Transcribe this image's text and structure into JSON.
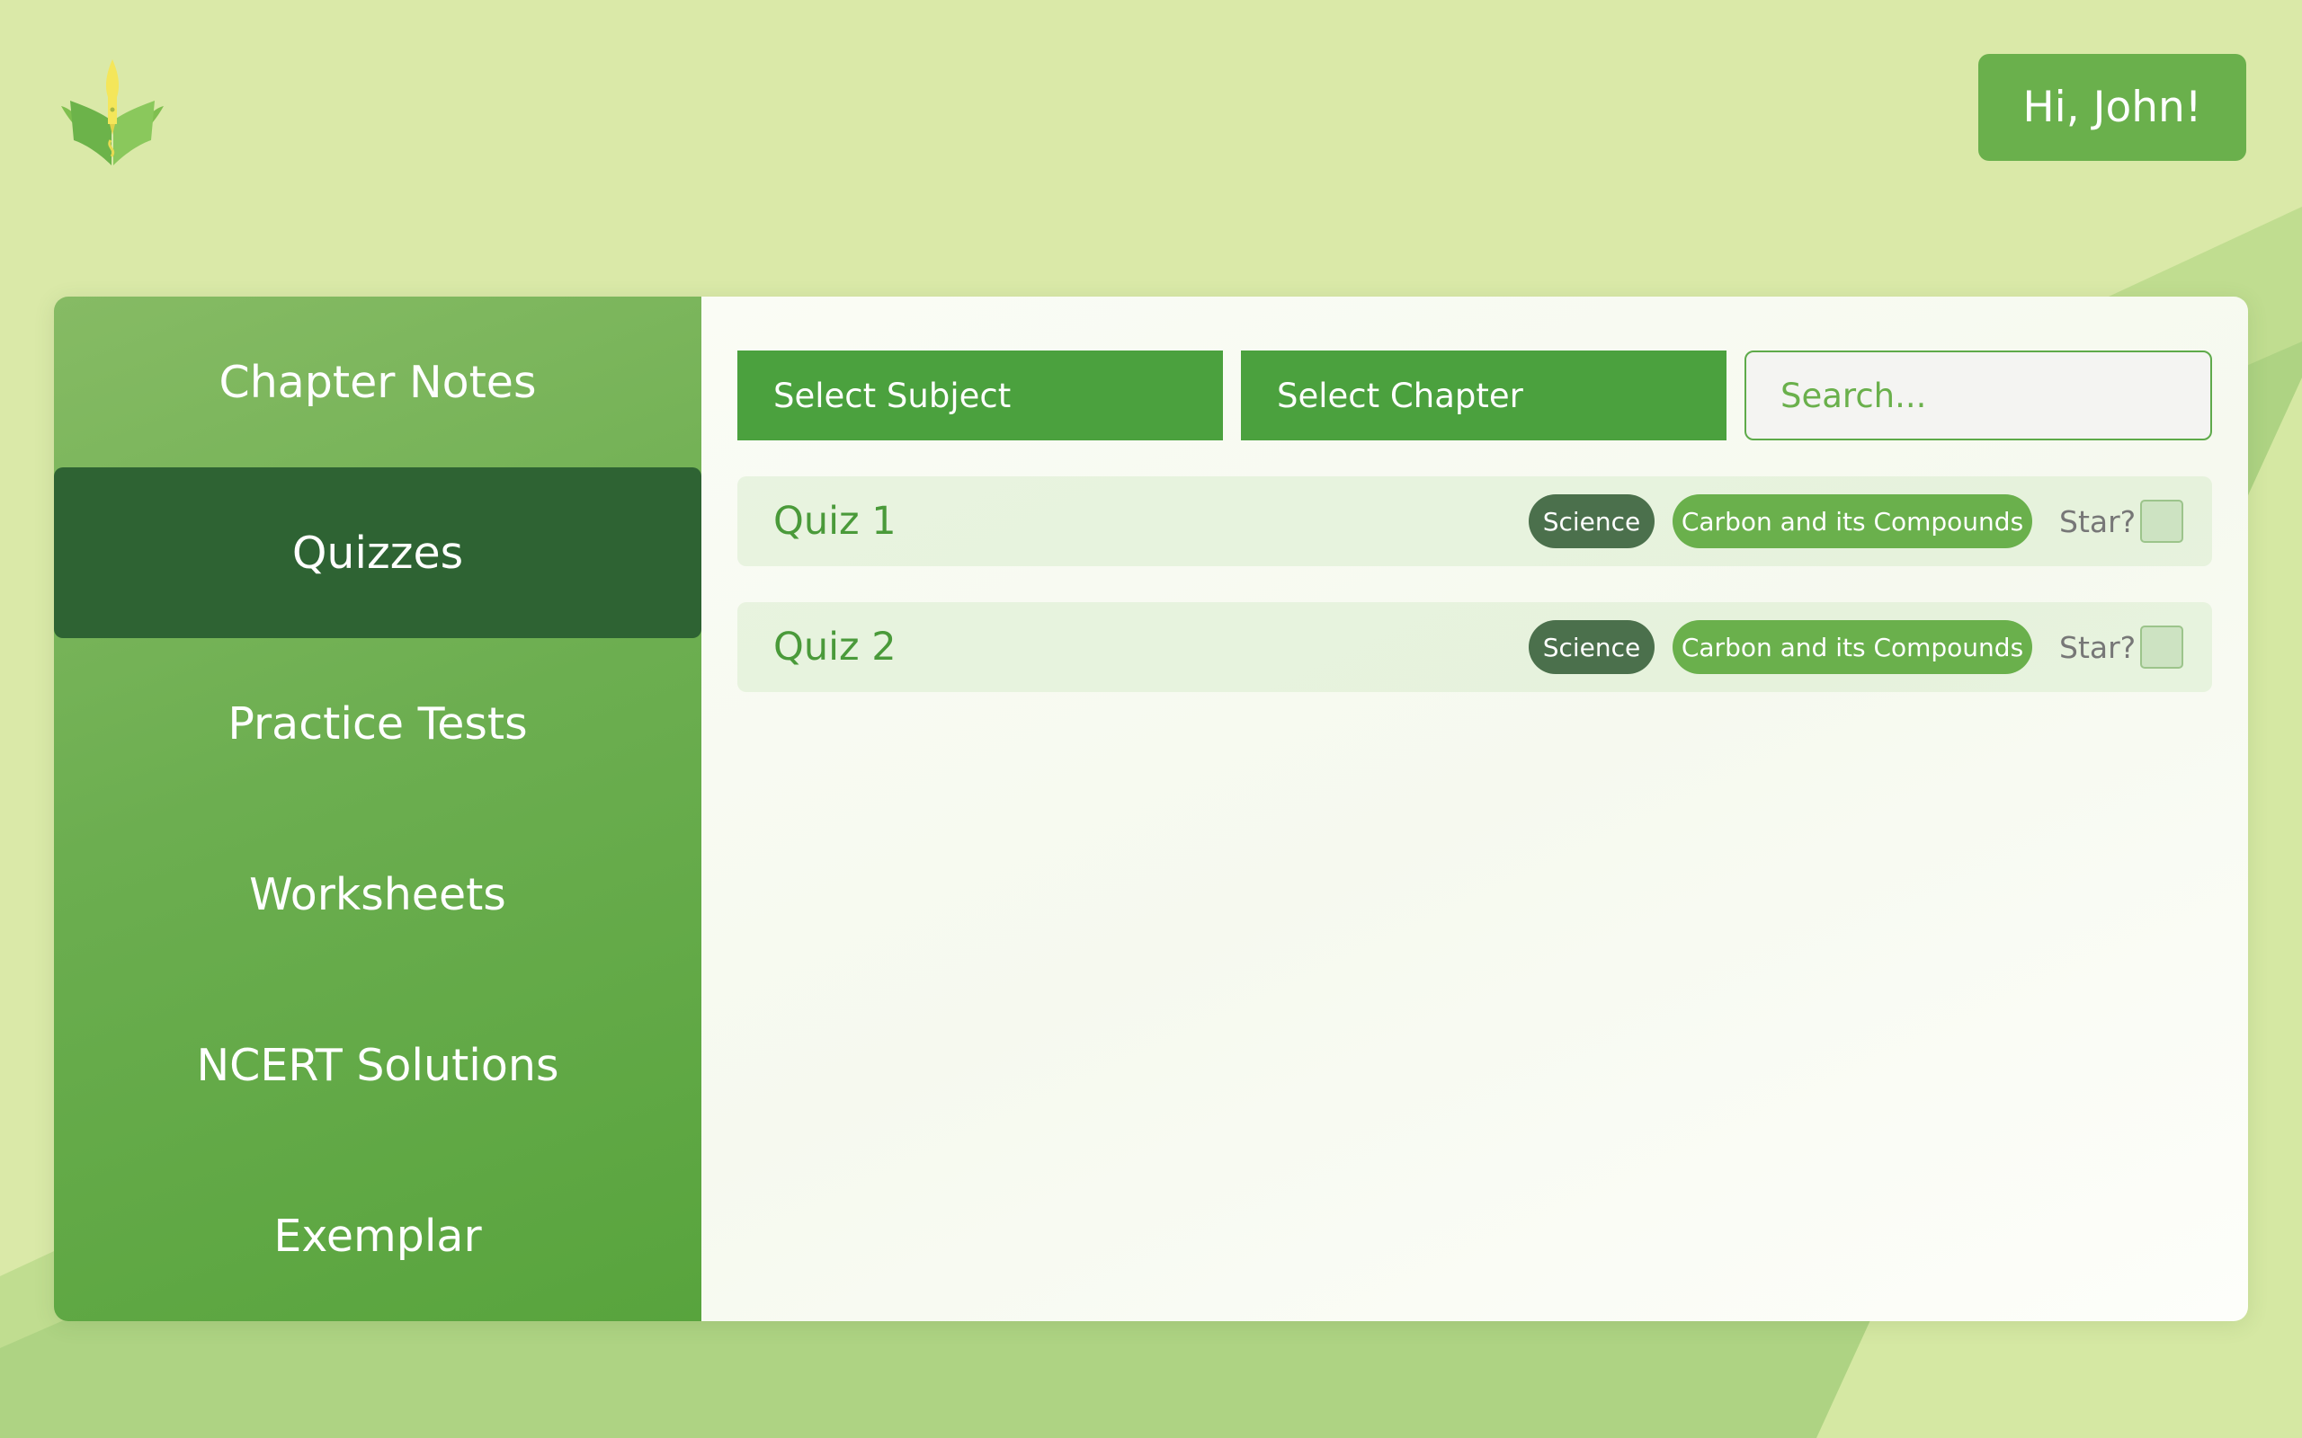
{
  "header": {
    "logo_icon": "pen-book-logo",
    "greeting": "Hi, John!"
  },
  "sidebar": {
    "items": [
      {
        "label": "Chapter Notes",
        "active": false
      },
      {
        "label": "Quizzes",
        "active": true
      },
      {
        "label": "Practice Tests",
        "active": false
      },
      {
        "label": "Worksheets",
        "active": false
      },
      {
        "label": "NCERT Solutions",
        "active": false
      },
      {
        "label": "Exemplar",
        "active": false
      }
    ]
  },
  "filters": {
    "subject_label": "Select Subject",
    "chapter_label": "Select Chapter",
    "search_placeholder": "Search...",
    "search_value": ""
  },
  "quizzes": [
    {
      "title": "Quiz 1",
      "subject": "Science",
      "chapter": "Carbon and its Compounds",
      "star_label": "Star?",
      "starred": false
    },
    {
      "title": "Quiz 2",
      "subject": "Science",
      "chapter": "Carbon and its Compounds",
      "star_label": "Star?",
      "starred": false
    }
  ],
  "colors": {
    "background": "#dae9a8",
    "accent": "#6ab04c",
    "button": "#4ba13e",
    "active_nav": "#2e6333",
    "subject_badge": "#4b704c"
  }
}
